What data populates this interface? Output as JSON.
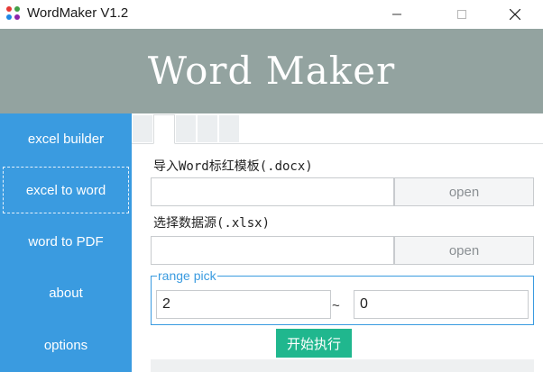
{
  "window": {
    "title": "WordMaker V1.2",
    "app_icon": "four-dot-icon",
    "controls": {
      "minimize": "minimize-icon",
      "maximize": "maximize-icon",
      "close": "close-icon"
    }
  },
  "banner": {
    "title": "Word Maker"
  },
  "sidebar": {
    "items": [
      {
        "label": "excel builder"
      },
      {
        "label": "excel to word",
        "active": true
      },
      {
        "label": "word to PDF"
      },
      {
        "label": "about"
      },
      {
        "label": "options"
      }
    ]
  },
  "form": {
    "template_label": "导入Word标红模板(.docx)",
    "template_value": "",
    "template_open": "open",
    "source_label": "选择数据源(.xlsx)",
    "source_value": "",
    "source_open": "open",
    "range": {
      "title": "range pick",
      "from": "2",
      "separator": "~",
      "to": "0"
    },
    "run_label": "开始执行"
  },
  "colors": {
    "banner": "#93a3a0",
    "sidebar": "#3a9be0",
    "accent": "#3a9be0",
    "run_button": "#20b78e"
  }
}
